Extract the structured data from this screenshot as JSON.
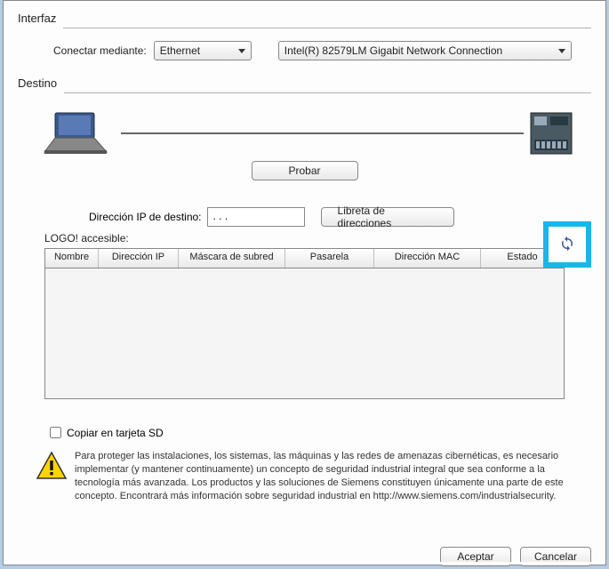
{
  "sections": {
    "interface_title": "Interfaz",
    "target_title": "Destino"
  },
  "interface": {
    "connect_via_label": "Conectar mediante:",
    "connect_via_value": "Ethernet",
    "nic_value": "Intel(R) 82579LM Gigabit Network Connection"
  },
  "target": {
    "probar_label": "Probar",
    "ip_label": "Dirección IP de destino:",
    "ip_value": "  .   .   .",
    "addressbook_label": "Libreta de direcciones",
    "accessible_label": "LOGO! accesible:",
    "refresh_icon_name": "refresh-icon"
  },
  "table": {
    "headers": {
      "name": "Nombre",
      "ip": "Dirección IP",
      "subnet": "Máscara de subred",
      "gateway": "Pasarela",
      "mac": "Dirección MAC",
      "state": "Estado"
    },
    "rows": []
  },
  "sd": {
    "copy_label": "Copiar en tarjeta SD",
    "checked": false
  },
  "warning": {
    "text": "Para proteger las instalaciones, los sistemas, las máquinas y las redes de amenazas cibernéticas, es necesario implementar (y mantener continuamente) un concepto de seguridad industrial integral que sea conforme a la tecnología más avanzada. Los productos y las soluciones de Siemens constituyen únicamente una parte de este concepto. Encontrará más información sobre seguridad industrial en http://www.siemens.com/industrialsecurity."
  },
  "footer": {
    "ok_label": "Aceptar",
    "cancel_label": "Cancelar"
  }
}
